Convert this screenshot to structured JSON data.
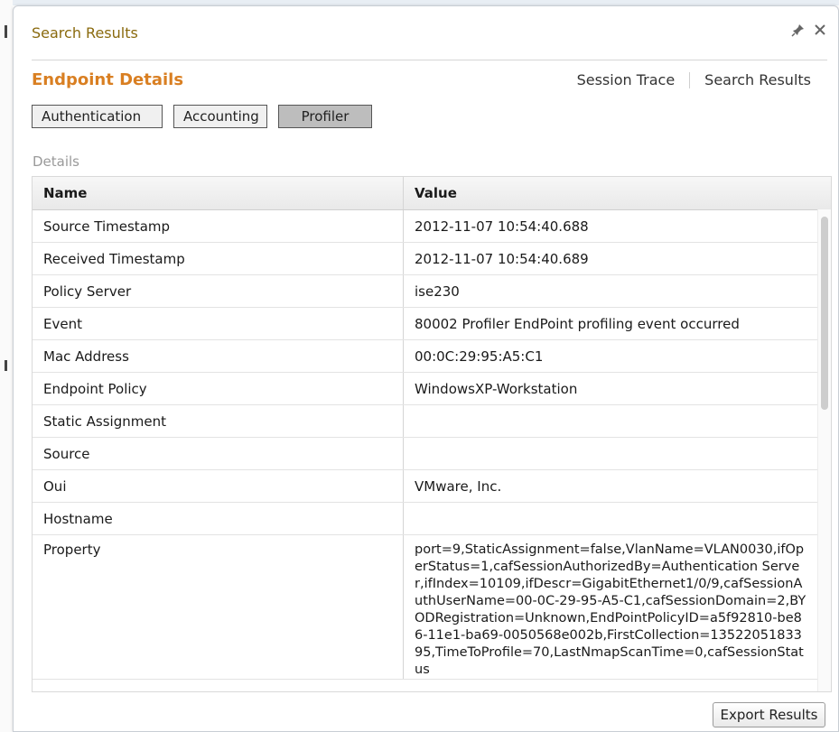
{
  "dialog": {
    "title": "Search Results",
    "icons": {
      "pin": "pin-icon",
      "close": "close-icon"
    }
  },
  "section": {
    "title": "Endpoint Details"
  },
  "top_links": {
    "session_trace": "Session Trace",
    "search_results": "Search Results"
  },
  "tabs": [
    {
      "label": "Authentication",
      "active": false
    },
    {
      "label": "Accounting",
      "active": false
    },
    {
      "label": "Profiler",
      "active": true
    }
  ],
  "details_label": "Details",
  "grid": {
    "columns": [
      "Name",
      "Value"
    ],
    "rows": [
      {
        "name": "Source Timestamp",
        "value": "2012-11-07 10:54:40.688"
      },
      {
        "name": "Received Timestamp",
        "value": "2012-11-07 10:54:40.689"
      },
      {
        "name": "Policy Server",
        "value": "ise230"
      },
      {
        "name": "Event",
        "value": "80002 Profiler EndPoint profiling event occurred"
      },
      {
        "name": "Mac Address",
        "value": "00:0C:29:95:A5:C1"
      },
      {
        "name": "Endpoint Policy",
        "value": "WindowsXP-Workstation"
      },
      {
        "name": "Static Assignment",
        "value": ""
      },
      {
        "name": "Source",
        "value": ""
      },
      {
        "name": "Oui",
        "value": "VMware, Inc."
      },
      {
        "name": "Hostname",
        "value": ""
      },
      {
        "name": "Property",
        "value": "port=9,StaticAssignment=false,VlanName=VLAN0030,ifOperStatus=1,cafSessionAuthorizedBy=Authentication Server,ifIndex=10109,ifDescr=GigabitEthernet1/0/9,cafSessionAuthUserName=00-0C-29-95-A5-C1,cafSessionDomain=2,BYODRegistration=Unknown,EndPointPolicyID=a5f92810-be86-11e1-ba69-0050568e002b,FirstCollection=1352205183395,TimeToProfile=70,LastNmapScanTime=0,cafSessionStatus"
      }
    ]
  },
  "export_button": "Export Results",
  "colors": {
    "section_title": "#d97f22",
    "dialog_title": "#8a6a0e",
    "active_tab": "#bdbdbd"
  }
}
